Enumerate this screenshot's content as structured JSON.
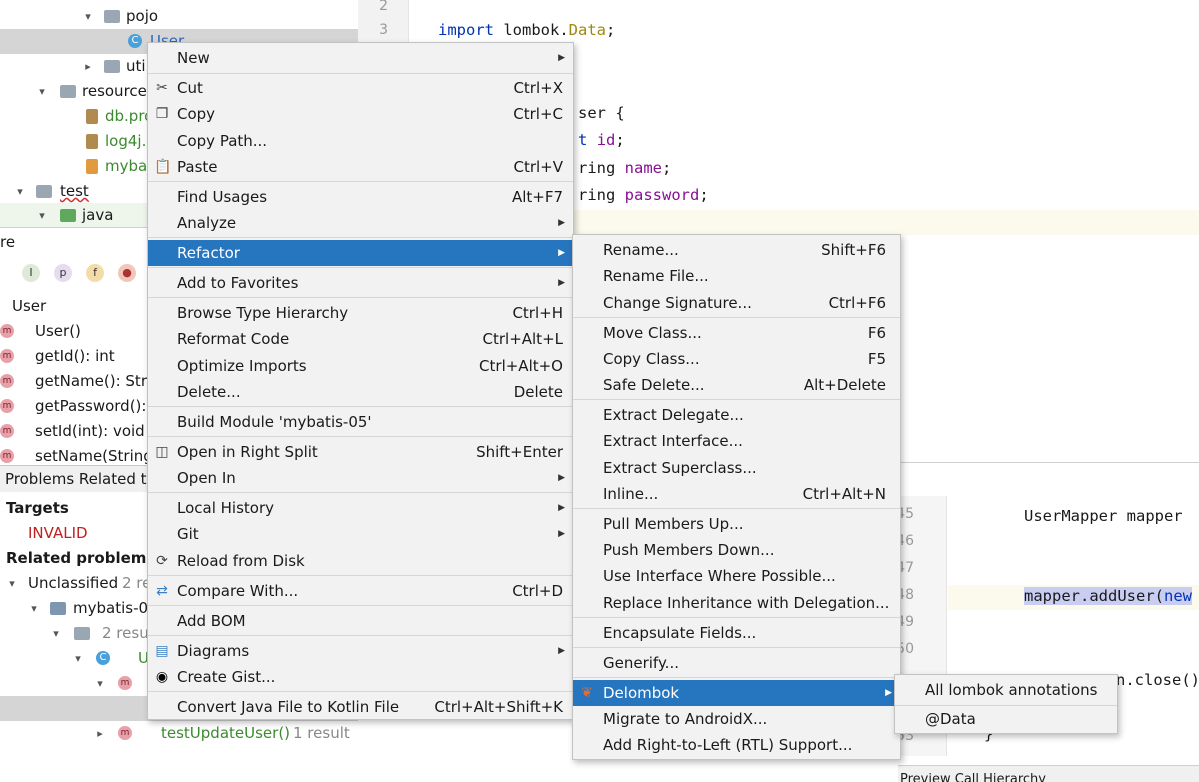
{
  "project_tree": {
    "items": [
      {
        "label": "pojo"
      },
      {
        "label": "User"
      },
      {
        "label": "uti"
      },
      {
        "label": "resource"
      },
      {
        "label": "db.pro"
      },
      {
        "label": "log4j."
      },
      {
        "label": "mybat"
      },
      {
        "label": "test"
      },
      {
        "label": "java"
      }
    ]
  },
  "structure": {
    "title": "re",
    "toolbar": [
      "I",
      "p",
      "f",
      "lock"
    ],
    "root": "User",
    "members": [
      "User()",
      "getId(): int",
      "getName(): Stri",
      "getPassword(): ",
      "setId(int): void",
      "setName(String"
    ]
  },
  "problems": {
    "title": "Problems Related to",
    "targets_label": "Targets",
    "invalid": "INVALID",
    "related_label": "Related problems",
    "related_count": "2",
    "unclassified": "Unclassified",
    "unclassified_count": "2 re",
    "module": "mybatis-0",
    "folder_count": "2 resu",
    "class_partial": "U",
    "test_method": "testUpdateUser()",
    "test_count": "1 result"
  },
  "editor_top": {
    "line_numbers": [
      "2",
      "3"
    ],
    "import_kw": "import",
    "import_pkg": "lombok.",
    "import_cls": "Data",
    "semicolon": ";",
    "frag_class": "ser {",
    "frag_id_type": "t",
    "frag_id": "id",
    "frag_name_type": "ring",
    "frag_name": "name",
    "frag_pwd_type": "ring",
    "frag_pwd": "password"
  },
  "editor_bottom": {
    "line_numbers": [
      "45",
      "46",
      "47",
      "48",
      "49",
      "50",
      "53"
    ],
    "line1": "UserMapper mapper",
    "line2": "mapper.addUser(",
    "line2_kw": "new",
    "line3": "n.close()",
    "line4": "}",
    "bottom_tabs": "Preview   Call Hierarchy"
  },
  "context_menu": {
    "items": [
      {
        "label": "New",
        "shortcut": "",
        "submenu": true
      },
      {
        "label": "Cut",
        "shortcut": "Ctrl+X",
        "icon": "cut-icon"
      },
      {
        "label": "Copy",
        "shortcut": "Ctrl+C",
        "icon": "copy-icon"
      },
      {
        "label": "Copy Path...",
        "shortcut": ""
      },
      {
        "label": "Paste",
        "shortcut": "Ctrl+V",
        "icon": "paste-icon"
      },
      {
        "label": "Find Usages",
        "shortcut": "Alt+F7"
      },
      {
        "label": "Analyze",
        "shortcut": "",
        "submenu": true
      },
      {
        "label": "Refactor",
        "shortcut": "",
        "submenu": true,
        "highlighted": true
      },
      {
        "label": "Add to Favorites",
        "shortcut": "",
        "submenu": true
      },
      {
        "label": "Browse Type Hierarchy",
        "shortcut": "Ctrl+H"
      },
      {
        "label": "Reformat Code",
        "shortcut": "Ctrl+Alt+L"
      },
      {
        "label": "Optimize Imports",
        "shortcut": "Ctrl+Alt+O"
      },
      {
        "label": "Delete...",
        "shortcut": "Delete"
      },
      {
        "label": "Build Module 'mybatis-05'",
        "shortcut": ""
      },
      {
        "label": "Open in Right Split",
        "shortcut": "Shift+Enter",
        "icon": "split-icon"
      },
      {
        "label": "Open In",
        "shortcut": "",
        "submenu": true
      },
      {
        "label": "Local History",
        "shortcut": "",
        "submenu": true
      },
      {
        "label": "Git",
        "shortcut": "",
        "submenu": true
      },
      {
        "label": "Reload from Disk",
        "shortcut": "",
        "icon": "reload-icon"
      },
      {
        "label": "Compare With...",
        "shortcut": "Ctrl+D",
        "icon": "compare-icon"
      },
      {
        "label": "Add BOM",
        "shortcut": ""
      },
      {
        "label": "Diagrams",
        "shortcut": "",
        "submenu": true,
        "icon": "diagram-icon"
      },
      {
        "label": "Create Gist...",
        "shortcut": "",
        "icon": "github-icon"
      },
      {
        "label": "Convert Java File to Kotlin File",
        "shortcut": "Ctrl+Alt+Shift+K"
      }
    ]
  },
  "refactor_menu": {
    "items": [
      {
        "label": "Rename...",
        "shortcut": "Shift+F6"
      },
      {
        "label": "Rename File...",
        "shortcut": ""
      },
      {
        "label": "Change Signature...",
        "shortcut": "Ctrl+F6"
      },
      {
        "label": "Move Class...",
        "shortcut": "F6"
      },
      {
        "label": "Copy Class...",
        "shortcut": "F5"
      },
      {
        "label": "Safe Delete...",
        "shortcut": "Alt+Delete"
      },
      {
        "label": "Extract Delegate...",
        "shortcut": ""
      },
      {
        "label": "Extract Interface...",
        "shortcut": ""
      },
      {
        "label": "Extract Superclass...",
        "shortcut": ""
      },
      {
        "label": "Inline...",
        "shortcut": "Ctrl+Alt+N"
      },
      {
        "label": "Pull Members Up...",
        "shortcut": ""
      },
      {
        "label": "Push Members Down...",
        "shortcut": ""
      },
      {
        "label": "Use Interface Where Possible...",
        "shortcut": ""
      },
      {
        "label": "Replace Inheritance with Delegation...",
        "shortcut": ""
      },
      {
        "label": "Encapsulate Fields...",
        "shortcut": ""
      },
      {
        "label": "Generify...",
        "shortcut": ""
      },
      {
        "label": "Delombok",
        "shortcut": "",
        "submenu": true,
        "highlighted": true
      },
      {
        "label": "Migrate to AndroidX...",
        "shortcut": ""
      },
      {
        "label": "Add Right-to-Left (RTL) Support...",
        "shortcut": ""
      }
    ]
  },
  "delombok_menu": {
    "items": [
      {
        "label": "All lombok annotations"
      },
      {
        "label": "@Data"
      }
    ]
  },
  "colors": {
    "menu_bg": "#f2f2f2",
    "highlight": "#2675bf",
    "keyword": "#0033b3",
    "field": "#871094"
  }
}
